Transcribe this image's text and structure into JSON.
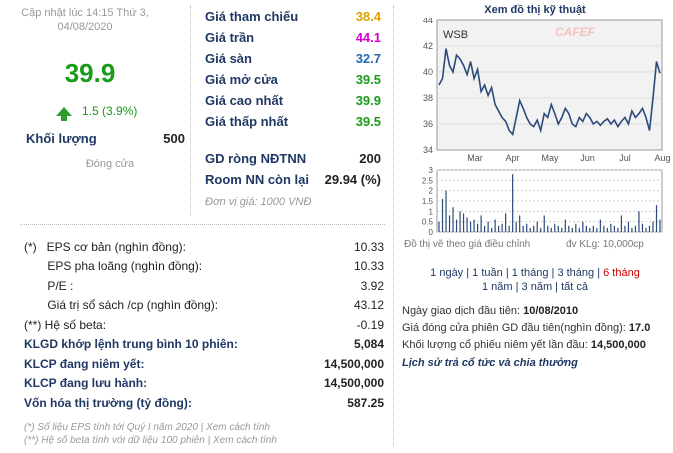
{
  "header": {
    "updated": "Cập nhật lúc 14:15 Thứ 3, 04/08/2020",
    "price": "39.9",
    "change": "1.5 (3.9%)",
    "volume_label": "Khối lượng",
    "volume_value": "500",
    "status": "Đóng cửa"
  },
  "reference": [
    {
      "label": "Giá tham chiếu",
      "value": "38.4",
      "color": "#e0a000"
    },
    {
      "label": "Giá trần",
      "value": "44.1",
      "color": "#d000d0"
    },
    {
      "label": "Giá sàn",
      "value": "32.7",
      "color": "#1f6ab0"
    },
    {
      "label": "Giá mở cửa",
      "value": "39.5",
      "color": "#1a9b1a"
    },
    {
      "label": "Giá cao nhất",
      "value": "39.9",
      "color": "#1a9b1a"
    },
    {
      "label": "Giá thấp nhất",
      "value": "39.5",
      "color": "#1a9b1a"
    }
  ],
  "foreign": [
    {
      "label": "GD ròng NĐTNN",
      "value": "200"
    },
    {
      "label": "Room NN còn lại",
      "value": "29.94 (%)"
    }
  ],
  "unit": "Đơn vị giá: 1000 VNĐ",
  "financials": [
    {
      "label": "(*)   EPS cơ bản (nghìn đồng):",
      "value": "10.33"
    },
    {
      "label": "       EPS pha loãng (nghìn đồng):",
      "value": "10.33"
    },
    {
      "label": "       P/E :",
      "value": "3.92"
    },
    {
      "label": "       Giá trị sổ sách /cp (nghìn đồng):",
      "value": "43.12"
    },
    {
      "label": "(**) Hệ số beta:",
      "value": "-0.19"
    },
    {
      "label": "KLGD khớp lệnh trung bình 10 phiên:",
      "value": "5,084",
      "bold": true
    },
    {
      "label": "KLCP đang niêm yết:",
      "value": "14,500,000",
      "bold": true
    },
    {
      "label": "KLCP đang lưu hành:",
      "value": "14,500,000",
      "bold": true
    },
    {
      "label": "Vốn hóa thị trường (tỷ đồng):",
      "value": "587.25",
      "bold": true
    }
  ],
  "notes": [
    "(*) Số liệu EPS tính tới Quý I năm 2020 | Xem cách tính",
    "(**) Hệ số beta tính với dữ liệu 100 phiên | Xem cách tính"
  ],
  "chart": {
    "title": "Xem đồ thị kỹ thuật",
    "ticker": "WSB",
    "watermark": "CAFEF",
    "y_ticks": [
      "44",
      "42",
      "40",
      "38",
      "36",
      "34"
    ],
    "x_ticks": [
      "Mar",
      "Apr",
      "May",
      "Jun",
      "Jul",
      "Aug"
    ],
    "vol_ticks": [
      "3",
      "2.5",
      "2",
      "1.5",
      "1",
      "0.5",
      "0"
    ],
    "adjust_note": "Đồ thị vẽ theo giá điều chỉnh",
    "vol_unit": "đv KLg: 10,000cp",
    "line_color": "#2c4a7a",
    "bg_color": "#f2f2f2"
  },
  "chart_data": {
    "type": "line",
    "title": "",
    "ylim": [
      34,
      44
    ],
    "series": [
      {
        "values": [
          39.0,
          39.5,
          41.8,
          40.5,
          40.0,
          41.3,
          41.0,
          40.5,
          39.8,
          40.8,
          39.5,
          40.2,
          38.5,
          39.0,
          38.2,
          38.8,
          37.5,
          37.0,
          36.5,
          36.2,
          35.5,
          35.2,
          36.5,
          37.8,
          37.2,
          36.5,
          36.0,
          35.8,
          36.3,
          35.5,
          36.8,
          36.5,
          37.5,
          36.8,
          36.0,
          36.5,
          37.2,
          36.8,
          36.0,
          35.8,
          36.5,
          36.2,
          36.8,
          36.5,
          36.0,
          36.2,
          35.9,
          36.2,
          36.4,
          36.0,
          36.3,
          35.8,
          36.2,
          36.5,
          36.0,
          37.0,
          36.5,
          36.8,
          37.2,
          36.5,
          35.5,
          38.0,
          40.8,
          39.9
        ]
      }
    ],
    "volume": [
      0.5,
      1.6,
      2.0,
      0.8,
      1.2,
      0.6,
      1.0,
      0.9,
      0.7,
      0.5,
      0.6,
      0.4,
      0.8,
      0.3,
      0.5,
      0.2,
      0.6,
      0.3,
      0.4,
      0.9,
      0.3,
      2.8,
      0.5,
      0.8,
      0.3,
      0.4,
      0.2,
      0.3,
      0.5,
      0.2,
      0.8,
      0.3,
      0.2,
      0.4,
      0.3,
      0.2,
      0.6,
      0.3,
      0.2,
      0.4,
      0.2,
      0.5,
      0.3,
      0.2,
      0.3,
      0.2,
      0.6,
      0.3,
      0.2,
      0.4,
      0.3,
      0.2,
      0.8,
      0.3,
      0.5,
      0.2,
      0.3,
      1.0,
      0.4,
      0.2,
      0.3,
      0.5,
      1.3,
      0.6
    ]
  },
  "ranges": {
    "row1": [
      "1 ngày",
      "1 tuần",
      "1 tháng",
      "3 tháng",
      "6 tháng"
    ],
    "row2": [
      "1 năm",
      "3 năm",
      "tất cả"
    ],
    "active": "6 tháng"
  },
  "info": [
    {
      "label": "Ngày giao dịch đầu tiên: ",
      "value": "10/08/2010"
    },
    {
      "label": "Giá đóng cửa phiên GD đầu tiên(nghìn đồng): ",
      "value": "17.0"
    },
    {
      "label": "Khối lượng cổ phiếu niêm yết lần đầu: ",
      "value": "14,500,000"
    }
  ],
  "history_link": "Lịch sử trả cổ tức và chia thưởng"
}
